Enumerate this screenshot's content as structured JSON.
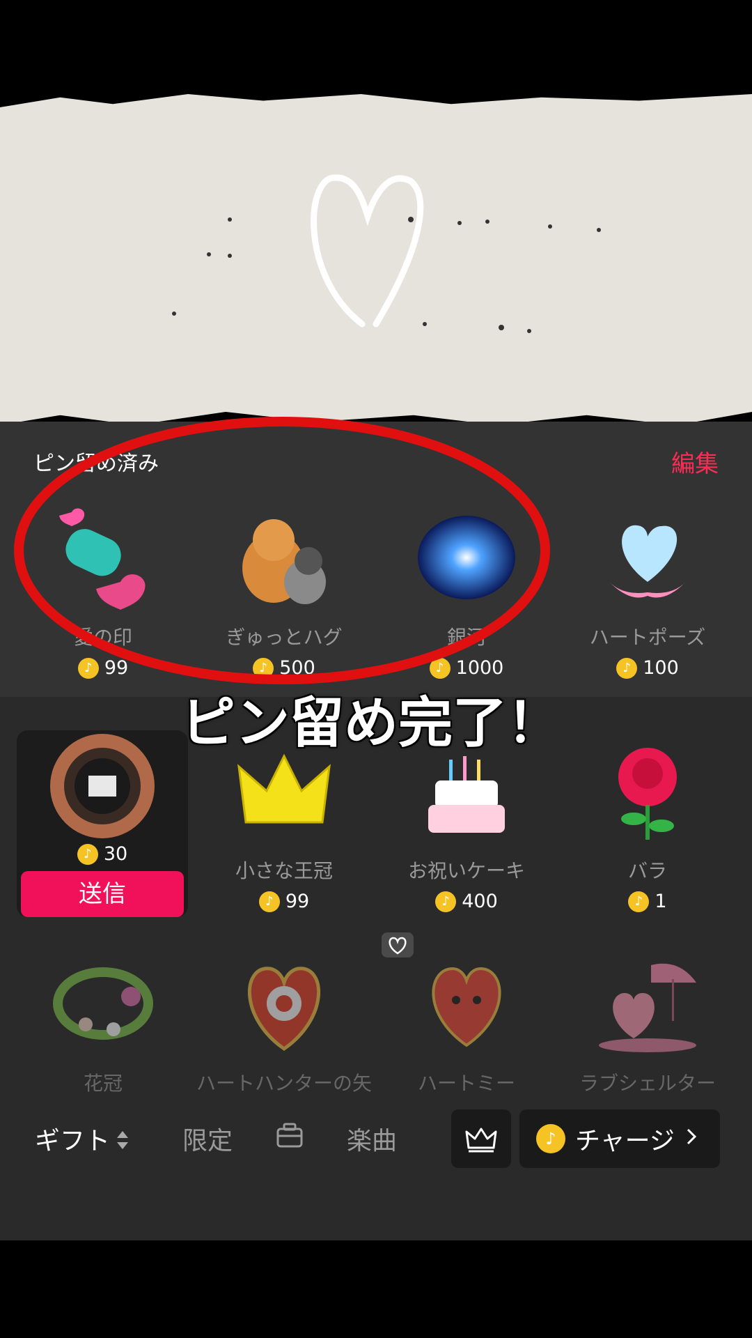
{
  "header": {
    "section_title": "ピン留め済み",
    "edit_label": "編集"
  },
  "overlay": {
    "caption": "ピン留め完了！"
  },
  "pinned_gifts": [
    {
      "name": "愛の印",
      "price": "99",
      "icon": "love-mark-icon"
    },
    {
      "name": "ぎゅっとハグ",
      "price": "500",
      "icon": "shiba-hug-icon"
    },
    {
      "name": "銀河",
      "price": "1000",
      "icon": "galaxy-icon"
    },
    {
      "name": "ハートポーズ",
      "price": "100",
      "icon": "heart-hands-icon"
    }
  ],
  "selected_gift": {
    "price": "30",
    "send_label": "送信",
    "icon": "castle-badge-icon"
  },
  "gifts_row2": [
    {
      "name": "小さな王冠",
      "price": "99",
      "icon": "crown-icon"
    },
    {
      "name": "お祝いケーキ",
      "price": "400",
      "icon": "cake-icon"
    },
    {
      "name": "バラ",
      "price": "1",
      "icon": "rose-icon"
    }
  ],
  "gifts_row3": [
    {
      "name": "花冠",
      "icon": "flower-crown-icon"
    },
    {
      "name": "ハートハンターの矢",
      "icon": "dartboard-icon"
    },
    {
      "name": "ハートミー",
      "icon": "heart-me-icon"
    },
    {
      "name": "ラブシェルター",
      "icon": "love-shelter-icon"
    }
  ],
  "tabs": {
    "gift": "ギフト",
    "limited": "限定",
    "music": "楽曲"
  },
  "charge": {
    "label": "チャージ"
  },
  "colors": {
    "accent": "#fe2c55",
    "send": "#f1115a",
    "coin": "#f6c325",
    "panel": "#2a2a2a"
  }
}
